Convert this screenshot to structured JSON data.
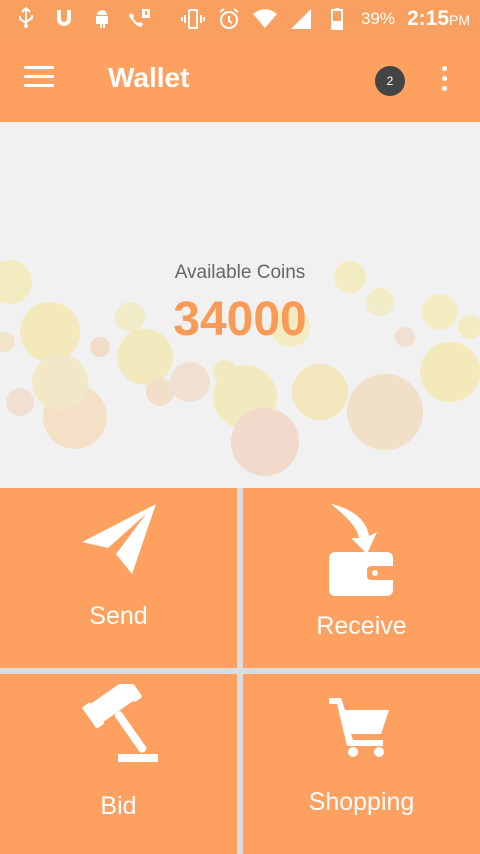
{
  "status_bar": {
    "battery_percent": "39%",
    "time": "2:15",
    "time_suffix": "PM",
    "icons": [
      "usb-icon",
      "magnet-icon",
      "android-icon",
      "missed-call-icon",
      "vibrate-icon",
      "alarm-icon",
      "wifi-icon",
      "signal-icon",
      "battery-icon"
    ]
  },
  "app_bar": {
    "title": "Wallet",
    "notification_count": "2",
    "menu_icon": "menu-icon",
    "overflow_icon": "more-vert-icon"
  },
  "wallet": {
    "label": "Available Coins",
    "coins": "34000"
  },
  "actions": [
    {
      "label": "Send",
      "icon": "paper-plane-icon"
    },
    {
      "label": "Receive",
      "icon": "wallet-receive-icon"
    },
    {
      "label": "Bid",
      "icon": "gavel-icon"
    },
    {
      "label": "Shopping",
      "icon": "cart-icon"
    }
  ],
  "colors": {
    "primary": "#fea05f",
    "accent_text": "#f99a57",
    "badge": "#444444",
    "background": "#f1f1f1"
  }
}
